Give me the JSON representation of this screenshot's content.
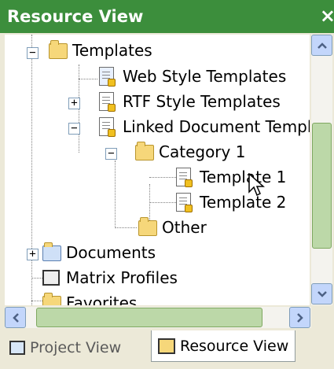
{
  "window": {
    "title": "Resource View",
    "close_glyph": "×"
  },
  "tree": {
    "items": [
      {
        "label": "Templates",
        "icon": "template-folder-icon",
        "expander": "−"
      },
      {
        "label": "Web Style Templates",
        "icon": "web-template-icon"
      },
      {
        "label": "RTF Style Templates",
        "icon": "document-icon",
        "expander": "+"
      },
      {
        "label": "Linked Document Templa",
        "icon": "document-icon",
        "expander": "−"
      },
      {
        "label": "Category 1",
        "icon": "folder-icon",
        "expander": "−"
      },
      {
        "label": "Template 1",
        "icon": "document-icon"
      },
      {
        "label": "Template 2",
        "icon": "document-icon"
      },
      {
        "label": "Other",
        "icon": "folder-icon"
      },
      {
        "label": "Documents",
        "icon": "documents-icon",
        "expander": "+"
      },
      {
        "label": "Matrix Profiles",
        "icon": "matrix-icon"
      },
      {
        "label": "Favorites",
        "icon": "favorites-icon"
      }
    ]
  },
  "tabs": [
    {
      "label": "Project View",
      "icon": "project-view-icon",
      "active": false
    },
    {
      "label": "Resource View",
      "icon": "resource-view-icon",
      "active": true
    }
  ],
  "colors": {
    "title_bar": "#3c8e3c",
    "scroll_thumb": "#bcd8a8"
  }
}
